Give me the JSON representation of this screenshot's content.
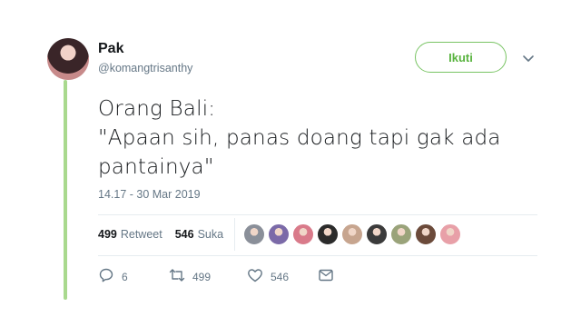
{
  "user": {
    "display_name": "Pak",
    "handle": "@komangtrisanthy"
  },
  "follow_button": {
    "label": "Ikuti"
  },
  "tweet": {
    "lines": [
      "Orang Bali:",
      "\"Apaan sih, panas doang tapi gak ada",
      "pantainya\""
    ],
    "timestamp": "14.17 - 30 Mar 2019"
  },
  "stats": {
    "retweets_count": "499",
    "retweets_label": "Retweet",
    "likes_count": "546",
    "likes_label": "Suka"
  },
  "likers": [
    {
      "name": "liker-avatar-1",
      "color": "#8a8f99"
    },
    {
      "name": "liker-avatar-2",
      "color": "#7b6aa8"
    },
    {
      "name": "liker-avatar-3",
      "color": "#d97a8a"
    },
    {
      "name": "liker-avatar-4",
      "color": "#2b2b2b"
    },
    {
      "name": "liker-avatar-5",
      "color": "#c7a58f"
    },
    {
      "name": "liker-avatar-6",
      "color": "#3b3b3b"
    },
    {
      "name": "liker-avatar-7",
      "color": "#9aa37a"
    },
    {
      "name": "liker-avatar-8",
      "color": "#6b4a3a"
    },
    {
      "name": "liker-avatar-9",
      "color": "#e8a0a8"
    }
  ],
  "actions": {
    "reply_count": "6",
    "retweet_count": "499",
    "like_count": "546"
  },
  "colors": {
    "thread_line": "#a9d98e",
    "follow_accent": "#58b33e",
    "muted_text": "#657786"
  },
  "icons": {
    "chevron": "chevron-down-icon",
    "reply": "reply-icon",
    "retweet": "retweet-icon",
    "like": "heart-icon",
    "message": "envelope-icon"
  }
}
